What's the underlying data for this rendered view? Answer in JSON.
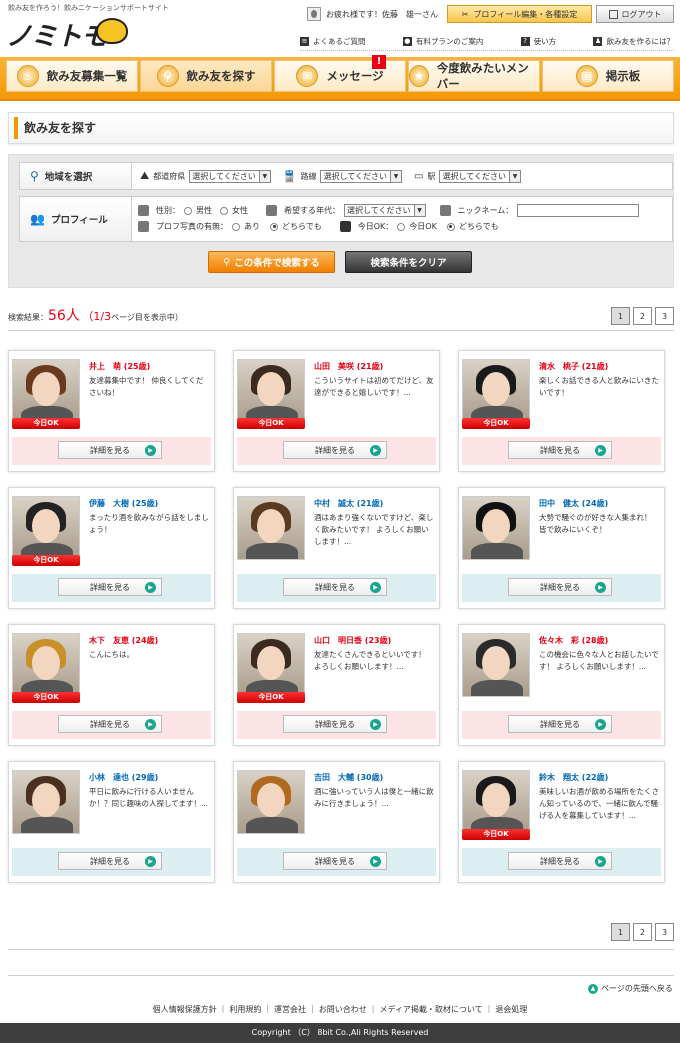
{
  "header": {
    "tagline": "飲み友を作ろう！飲みニケーションサポートサイト",
    "logo_text": "ノミトモ",
    "greeting": "お疲れ様です！佐藤　雄一さん",
    "profile_button": "プロフィール編集・各種設定",
    "logout_button": "ログアウト",
    "sublinks": [
      "よくあるご質問",
      "有料プランのご案内",
      "使い方",
      "飲み友を作るには？"
    ]
  },
  "nav": {
    "items": [
      {
        "label": "飲み友募集一覧",
        "icon": "beer-icon"
      },
      {
        "label": "飲み友を探す",
        "icon": "magnifier-icon"
      },
      {
        "label": "メッセージ",
        "icon": "envelope-icon"
      },
      {
        "label": "今度飲みたいメンバー",
        "icon": "star-icon"
      },
      {
        "label": "掲示板",
        "icon": "board-icon"
      }
    ],
    "message_badge": "!"
  },
  "page_title": "飲み友を探す",
  "search": {
    "region_label": "地域を選択",
    "prefecture_label": "都道府県",
    "prefecture_value": "選択してください",
    "line_label": "路線",
    "line_value": "選択してください",
    "station_label": "駅",
    "station_value": "選択してください",
    "profile_label": "プロフィール",
    "gender_label": "性別：",
    "gender_male": "男性",
    "gender_female": "女性",
    "age_label": "希望する年代：",
    "age_value": "選択してください",
    "nickname_label": "ニックネーム：",
    "nickname_value": "",
    "photo_label": "プロフ写真の有無：",
    "photo_yes": "あり",
    "photo_either": "どちらでも",
    "today_label": "今日OK：",
    "today_ok": "今日OK",
    "today_either": "どちらでも",
    "search_button": "この条件で検索する",
    "clear_button": "検索条件をクリア"
  },
  "results": {
    "prefix": "検索結果：",
    "count": "56人",
    "pages": "（1/3",
    "suffix": "ページ目を表示中）",
    "pager": [
      "1",
      "2",
      "3"
    ]
  },
  "detail_label": "詳細を見る",
  "today_ok_badge": "今日OK",
  "cards": [
    {
      "name": "井上　萌 (25歳)",
      "gender": "f",
      "today": true,
      "msg": "友達募集中です！ 仲良くしてくださいね！"
    },
    {
      "name": "山田　美咲 (21歳)",
      "gender": "f",
      "today": true,
      "msg": "こういうサイトは初めてだけど、友達ができると嬉しいです！..."
    },
    {
      "name": "清水　桃子 (21歳)",
      "gender": "f",
      "today": true,
      "msg": "楽しくお話できる人と飲みにいきたいです！"
    },
    {
      "name": "伊藤　大樹 (25歳)",
      "gender": "m",
      "today": true,
      "msg": "まったり酒を飲みながら話をしましょう！"
    },
    {
      "name": "中村　誠太 (21歳)",
      "gender": "m",
      "today": false,
      "msg": "酒はあまり強くないですけど、楽しく飲みたいです！ よろしくお願いします！..."
    },
    {
      "name": "田中　健太 (24歳)",
      "gender": "m",
      "today": false,
      "msg": "大勢で騒ぐのが好きな人集まれ！ 皆で飲みにいくぞ！"
    },
    {
      "name": "木下　友恵 (24歳)",
      "gender": "f",
      "today": true,
      "msg": "こんにちは。"
    },
    {
      "name": "山口　明日香 (23歳)",
      "gender": "f",
      "today": true,
      "msg": "友達たくさんできるといいです！ よろしくお願いします！..."
    },
    {
      "name": "佐々木　彩 (28歳)",
      "gender": "f",
      "today": false,
      "msg": "この機会に色々な人とお話したいです！ よろしくお願いします！..."
    },
    {
      "name": "小林　達也 (29歳)",
      "gender": "m",
      "today": false,
      "msg": "平日に飲みに行ける人いませんか！？同じ趣味の人探してます！..."
    },
    {
      "name": "吉田　大輔 (30歳)",
      "gender": "m",
      "today": false,
      "msg": "酒に強いっていう人は僕と一緒に飲みに行きましょう！..."
    },
    {
      "name": "鈴木　翔太 (22歳)",
      "gender": "m",
      "today": true,
      "msg": "美味しいお酒が飲める場所をたくさん知っているので、一緒に飲んで騒げる人を募集しています！..."
    }
  ],
  "footer": {
    "pagetop": "ページの先頭へ戻る",
    "links": [
      "個人情報保護方針",
      "利用規約",
      "運営会社",
      "お問い合わせ",
      "メディア掲載・取材について",
      "退会処理"
    ],
    "copyright": "Copyright （C） 8bit Co.,Ali Rights Reserved"
  },
  "colors": {
    "accent": "#f39800",
    "female": "#e60012",
    "male": "#0068b7",
    "go": "#1aa58c"
  }
}
